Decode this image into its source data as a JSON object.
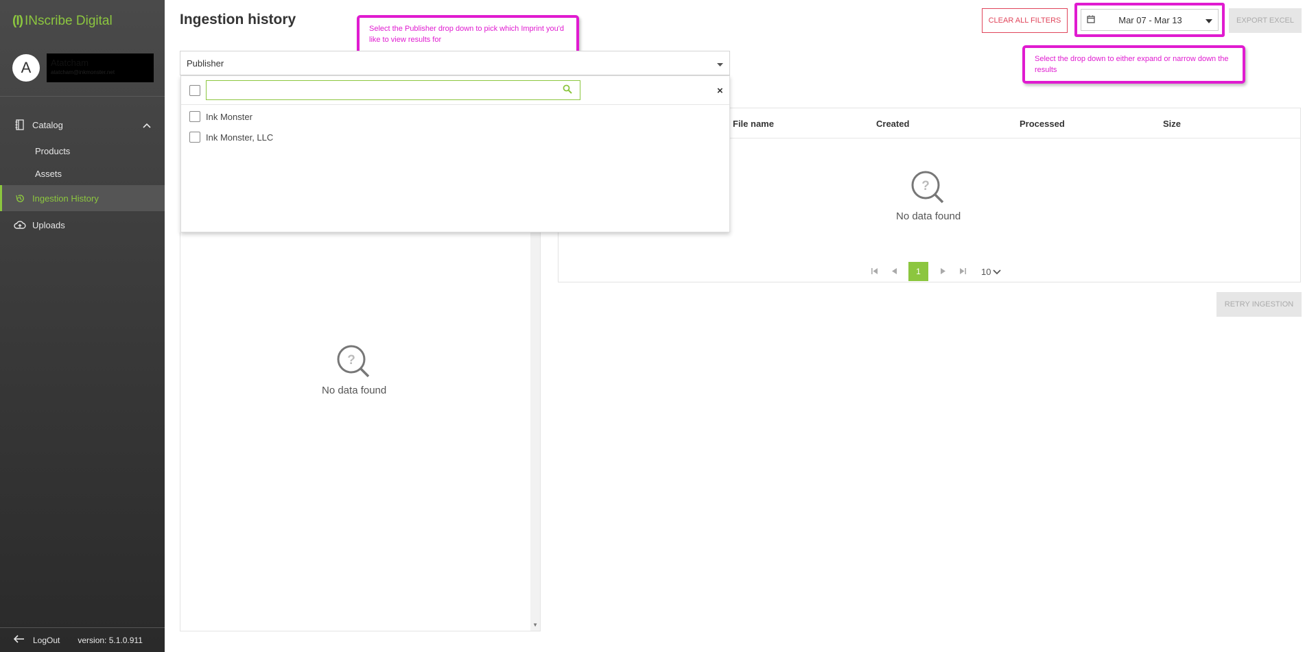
{
  "app": {
    "logo_mark": "(I)",
    "logo_text": "INscribe Digital"
  },
  "user": {
    "initial": "A",
    "name": "Atatcham",
    "email": "atatcham@inkmonster.net"
  },
  "sidebar": {
    "items": [
      {
        "label": "Catalog",
        "icon": "book-icon"
      },
      {
        "label": "Products"
      },
      {
        "label": "Assets"
      },
      {
        "label": "Ingestion History",
        "icon": "history-icon",
        "active": true
      },
      {
        "label": "Uploads",
        "icon": "cloud-upload-icon"
      }
    ],
    "logout_label": "LogOut",
    "version": "version: 5.1.0.911"
  },
  "page": {
    "title": "Ingestion history"
  },
  "toolbar": {
    "clear_filters_label": "CLEAR ALL FILTERS",
    "date_range": "Mar 07 - Mar 13",
    "export_label": "EXPORT EXCEL",
    "retry_label": "RETRY INGESTION"
  },
  "callouts": {
    "publisher_tip": "Select the Publisher drop down to pick which Imprint you'd like to view results for",
    "date_tip": "Select the drop down to either expand or narrow down the results"
  },
  "publisher_filter": {
    "label": "Publisher",
    "search_value": "",
    "options": [
      "Ink Monster",
      "Ink Monster, LLC"
    ]
  },
  "table": {
    "columns": [
      "File name",
      "Created",
      "Processed",
      "Size"
    ],
    "empty_text": "No data found",
    "pagination": {
      "current_page": "1",
      "page_size": "10"
    }
  },
  "left_panel": {
    "empty_text": "No data found"
  },
  "colors": {
    "accent_green": "#8cc63f",
    "callout_magenta": "#e01bd0",
    "clear_red": "#e0445a"
  }
}
